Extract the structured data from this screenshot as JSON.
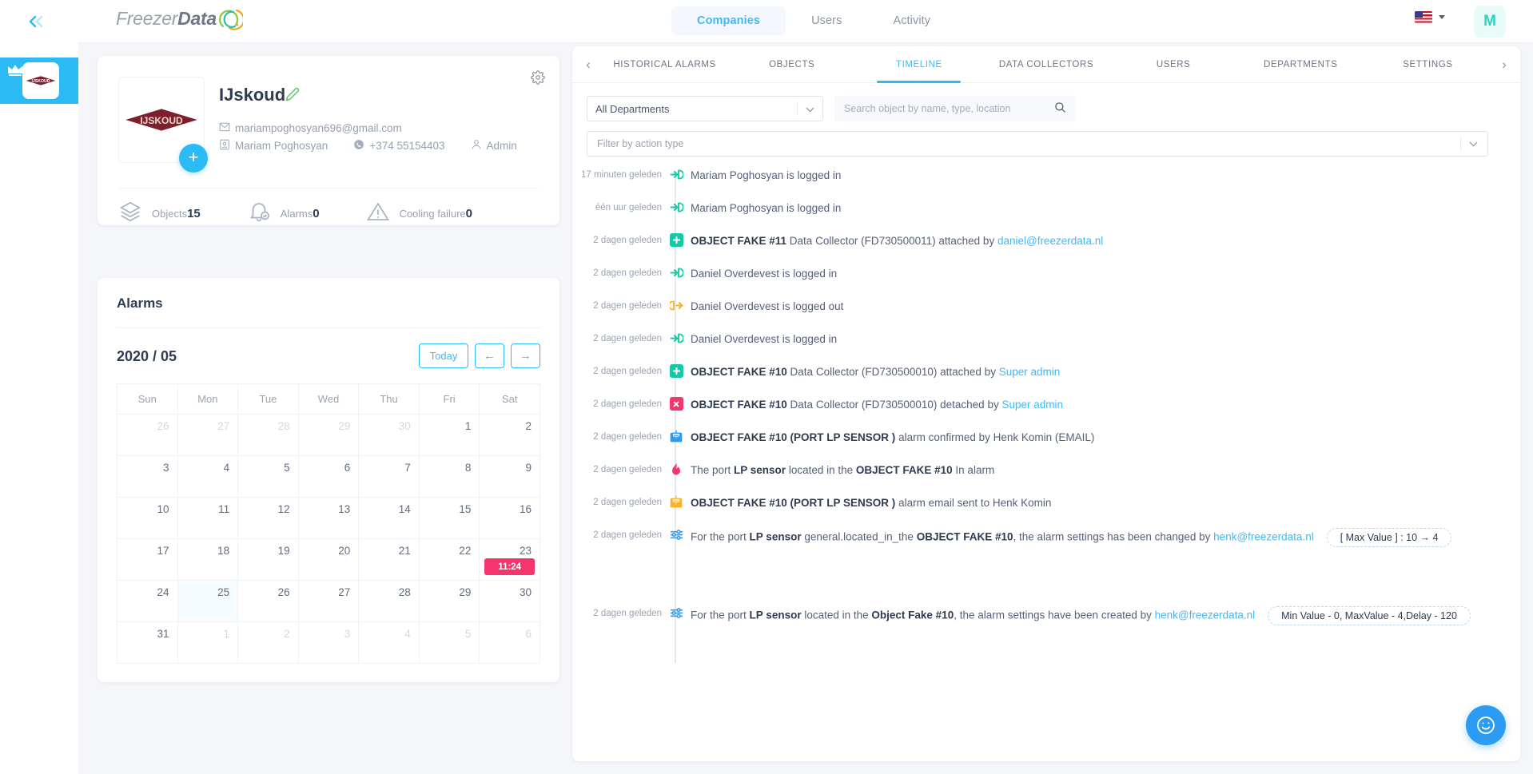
{
  "brand": {
    "name_light": "Freezer",
    "name_bold": "Data"
  },
  "topnav": {
    "tabs": [
      {
        "label": "Companies",
        "active": true
      },
      {
        "label": "Users",
        "active": false
      },
      {
        "label": "Activity",
        "active": false
      }
    ],
    "language_icon": "us-flag-icon",
    "avatar_initial": "M"
  },
  "rail": {
    "collapse_icon": "double-chevron-left-icon",
    "company_icon": "company-logo-icon",
    "crown_icon": "crown-icon"
  },
  "company": {
    "name": "IJskoud",
    "logo_text": "IJSKOUD",
    "email": "mariampoghosyan696@gmail.com",
    "contact": "Mariam Poghosyan",
    "phone": "+374 55154403",
    "role": "Admin",
    "add_label": "+",
    "stats": [
      {
        "label": "Objects",
        "value": "15",
        "icon": "layers-icon"
      },
      {
        "label": "Alarms",
        "value": "0",
        "icon": "bell-check-icon"
      },
      {
        "label": "Cooling failure",
        "value": "0",
        "icon": "warning-triangle-icon"
      }
    ]
  },
  "alarms_card": {
    "title": "Alarms",
    "month_label": "2020 / 05",
    "today_label": "Today",
    "prev_label": "←",
    "next_label": "→",
    "weekdays": [
      "Sun",
      "Mon",
      "Tue",
      "Wed",
      "Thu",
      "Fri",
      "Sat"
    ],
    "weeks": [
      [
        {
          "d": "26",
          "muted": true
        },
        {
          "d": "27",
          "muted": true
        },
        {
          "d": "28",
          "muted": true
        },
        {
          "d": "29",
          "muted": true
        },
        {
          "d": "30",
          "muted": true
        },
        {
          "d": "1"
        },
        {
          "d": "2"
        }
      ],
      [
        {
          "d": "3"
        },
        {
          "d": "4"
        },
        {
          "d": "5"
        },
        {
          "d": "6"
        },
        {
          "d": "7"
        },
        {
          "d": "8"
        },
        {
          "d": "9"
        }
      ],
      [
        {
          "d": "10"
        },
        {
          "d": "11"
        },
        {
          "d": "12"
        },
        {
          "d": "13"
        },
        {
          "d": "14"
        },
        {
          "d": "15"
        },
        {
          "d": "16"
        }
      ],
      [
        {
          "d": "17"
        },
        {
          "d": "18"
        },
        {
          "d": "19"
        },
        {
          "d": "20"
        },
        {
          "d": "21"
        },
        {
          "d": "22"
        },
        {
          "d": "23",
          "badge": "11:24"
        }
      ],
      [
        {
          "d": "24"
        },
        {
          "d": "25",
          "selected": true
        },
        {
          "d": "26"
        },
        {
          "d": "27"
        },
        {
          "d": "28"
        },
        {
          "d": "29"
        },
        {
          "d": "30"
        }
      ],
      [
        {
          "d": "31"
        },
        {
          "d": "1",
          "muted": true
        },
        {
          "d": "2",
          "muted": true
        },
        {
          "d": "3",
          "muted": true
        },
        {
          "d": "4",
          "muted": true
        },
        {
          "d": "5",
          "muted": true
        },
        {
          "d": "6",
          "muted": true
        }
      ]
    ]
  },
  "panel": {
    "prev_arrow": "‹",
    "next_arrow": "›",
    "tabs": [
      {
        "label": "HISTORICAL ALARMS",
        "active": false
      },
      {
        "label": "OBJECTS",
        "active": false
      },
      {
        "label": "TIMELINE",
        "active": true
      },
      {
        "label": "DATA COLLECTORS",
        "active": false
      },
      {
        "label": "USERS",
        "active": false
      },
      {
        "label": "DEPARTMENTS",
        "active": false
      },
      {
        "label": "SETTINGS",
        "active": false
      }
    ],
    "department_select": "All Departments",
    "search_placeholder": "Search object by name, type, location",
    "search_value": "",
    "action_filter_placeholder": "Filter by action type",
    "timeline": [
      {
        "time": "17 minuten geleden",
        "icon": "login-arrow-icon",
        "icon_color": "#14c9a5",
        "parts": [
          {
            "t": "Mariam Poghosyan is logged in"
          }
        ]
      },
      {
        "time": "één uur geleden",
        "icon": "login-arrow-icon",
        "icon_color": "#14c9a5",
        "parts": [
          {
            "t": "Mariam Poghosyan is logged in"
          }
        ]
      },
      {
        "time": "2 dagen geleden",
        "icon": "plus-square-icon",
        "icon_color": "#14c9a5",
        "parts": [
          {
            "t": "OBJECT FAKE #11",
            "s": "b"
          },
          {
            "t": " Data Collector (FD730500011) attached by "
          },
          {
            "t": "daniel@freezerdata.nl",
            "s": "a"
          }
        ]
      },
      {
        "time": "2 dagen geleden",
        "icon": "login-arrow-icon",
        "icon_color": "#14c9a5",
        "parts": [
          {
            "t": "Daniel Overdevest is logged in"
          }
        ]
      },
      {
        "time": "2 dagen geleden",
        "icon": "logout-arrow-icon",
        "icon_color": "#fbb229",
        "parts": [
          {
            "t": "Daniel Overdevest is logged out"
          }
        ]
      },
      {
        "time": "2 dagen geleden",
        "icon": "login-arrow-icon",
        "icon_color": "#14c9a5",
        "parts": [
          {
            "t": "Daniel Overdevest is logged in"
          }
        ]
      },
      {
        "time": "2 dagen geleden",
        "icon": "plus-square-icon",
        "icon_color": "#14c9a5",
        "parts": [
          {
            "t": "OBJECT FAKE #10",
            "s": "b"
          },
          {
            "t": " Data Collector (FD730500010) attached by "
          },
          {
            "t": "Super admin",
            "s": "a"
          }
        ]
      },
      {
        "time": "2 dagen geleden",
        "icon": "cross-square-icon",
        "icon_color": "#f5356e",
        "parts": [
          {
            "t": "OBJECT FAKE #10",
            "s": "b"
          },
          {
            "t": " Data Collector (FD730500010) detached by "
          },
          {
            "t": "Super admin",
            "s": "a"
          }
        ]
      },
      {
        "time": "2 dagen geleden",
        "icon": "email-alarm-icon",
        "icon_color": "#2b9bf4",
        "parts": [
          {
            "t": "OBJECT FAKE #10 (PORT LP SENSOR )",
            "s": "b"
          },
          {
            "t": " alarm confirmed by Henk Komin (EMAIL)"
          }
        ]
      },
      {
        "time": "2 dagen geleden",
        "icon": "flame-icon",
        "icon_color": "#f5356e",
        "parts": [
          {
            "t": "The port "
          },
          {
            "t": "LP sensor",
            "s": "b"
          },
          {
            "t": " located in the "
          },
          {
            "t": "OBJECT FAKE #10",
            "s": "b"
          },
          {
            "t": " In alarm"
          }
        ]
      },
      {
        "time": "2 dagen geleden",
        "icon": "email-alarm-icon",
        "icon_color": "#fbb229",
        "parts": [
          {
            "t": "OBJECT FAKE #10 (PORT LP SENSOR )",
            "s": "b"
          },
          {
            "t": " alarm email sent to Henk Komin"
          }
        ]
      },
      {
        "time": "2 dagen geleden",
        "icon": "sliders-icon",
        "icon_color": "#2b9bf4",
        "tall": true,
        "parts": [
          {
            "t": "For the port "
          },
          {
            "t": "LP sensor",
            "s": "b"
          },
          {
            "t": "  general.located_in_the  "
          },
          {
            "t": "OBJECT FAKE #10",
            "s": "b"
          },
          {
            "t": ", the alarm settings has been changed by "
          },
          {
            "t": "henk@freezerdata.nl",
            "s": "a"
          }
        ],
        "pill": "[ Max Value ] : 10 → 4"
      },
      {
        "time": "2 dagen geleden",
        "icon": "sliders-icon",
        "icon_color": "#2b9bf4",
        "parts": [
          {
            "t": "For the port "
          },
          {
            "t": "LP sensor",
            "s": "b"
          },
          {
            "t": "  located in the  "
          },
          {
            "t": "Object Fake #10",
            "s": "b"
          },
          {
            "t": ", the alarm settings have been created by "
          },
          {
            "t": "henk@freezerdata.nl",
            "s": "a"
          }
        ],
        "pill": "Min Value - 0, MaxValue - 4,Delay - 120"
      }
    ]
  },
  "chat": {
    "icon": "smiley-face-icon"
  },
  "colors": {
    "accent": "#2cbaf5",
    "green": "#14c9a5",
    "orange": "#fbb229",
    "pink": "#f5356e",
    "blue": "#2b9bf4"
  }
}
